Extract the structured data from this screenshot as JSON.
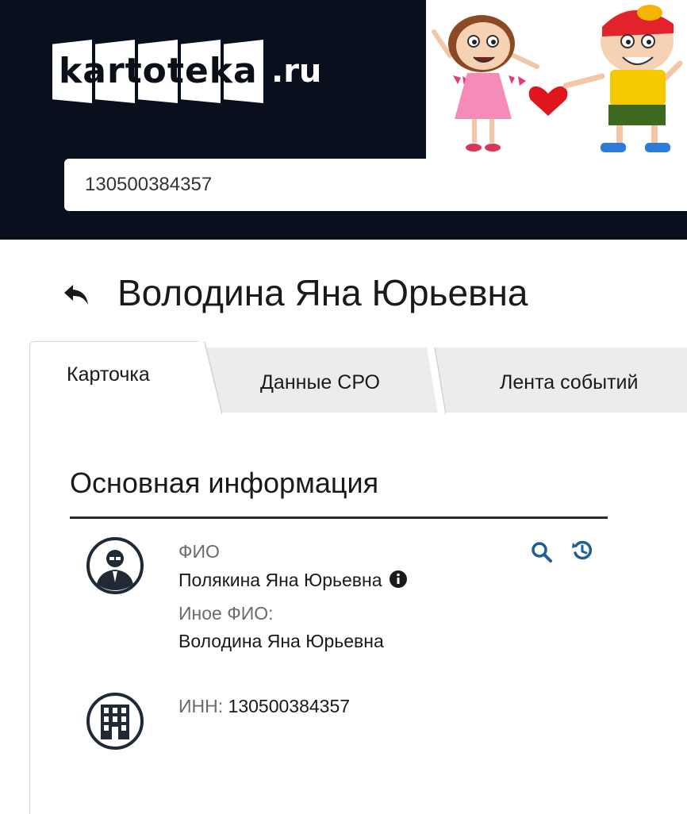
{
  "header": {
    "logo_word": "kartoteka",
    "logo_tld": ".ru",
    "search": {
      "value": "130500384357"
    }
  },
  "person": {
    "title": "Володина Яна Юрьевна"
  },
  "tabs": [
    {
      "label": "Карточка",
      "active": true
    },
    {
      "label": "Данные СРО",
      "active": false
    },
    {
      "label": "Лента событий",
      "active": false
    }
  ],
  "section": {
    "title": "Основная информация",
    "fio_label": "ФИО",
    "fio_value": "Полякина Яна Юрьевна",
    "other_fio_label": "Иное ФИО:",
    "other_fio_value": "Володина Яна Юрьевна",
    "inn_label": "ИНН:",
    "inn_value": "130500384357"
  },
  "icons": {
    "back": "back-arrow-icon",
    "person_avatar": "person-avatar-icon",
    "building_avatar": "building-icon",
    "info": "info-icon",
    "search": "search-icon",
    "history": "history-icon"
  },
  "colors": {
    "header_bg": "#07101c",
    "accent_blue": "#1f5f96",
    "tab_inactive": "#ececec"
  }
}
